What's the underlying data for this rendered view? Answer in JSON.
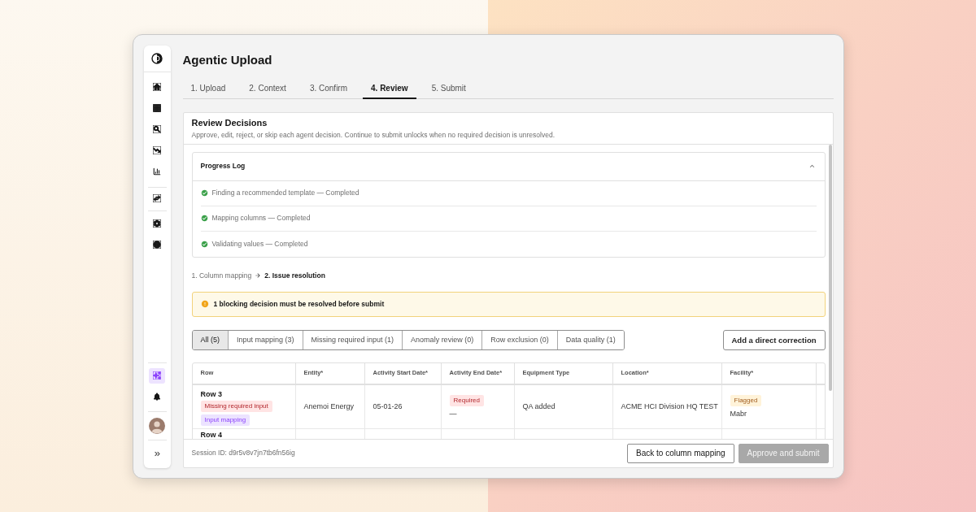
{
  "sidebar": {
    "groups": [
      {
        "items": [
          {
            "selected": false
          },
          {
            "selected": false
          },
          {
            "selected": false
          },
          {
            "selected": false
          },
          {
            "selected": false
          }
        ]
      },
      {
        "items": [
          {
            "selected": false
          }
        ]
      },
      {
        "items": [
          {
            "selected": false
          },
          {
            "selected": false
          }
        ]
      }
    ],
    "bottom_items": [
      {
        "selected": true
      },
      {
        "selected": false
      }
    ]
  },
  "page": {
    "title": "Agentic Upload"
  },
  "steps": [
    {
      "label": "1. Upload",
      "selected": false
    },
    {
      "label": "2. Context",
      "selected": false
    },
    {
      "label": "3. Confirm",
      "selected": false
    },
    {
      "label": "4. Review",
      "selected": true
    },
    {
      "label": "5. Submit",
      "selected": false
    }
  ],
  "review": {
    "title": "Review Decisions",
    "description": "Approve, edit, reject, or skip each agent decision. Continue to submit unlocks when no required decision is unresolved.",
    "progress_log": {
      "title": "Progress Log",
      "expanded": true,
      "items": [
        {
          "text": "Finding a recommended template — Completed",
          "done": true
        },
        {
          "text": "Mapping columns — Completed",
          "done": true
        },
        {
          "text": "Validating values — Completed",
          "done": true
        }
      ]
    },
    "stages": [
      {
        "label": "1. Column mapping",
        "selected": false
      },
      {
        "label": "2. Issue resolution",
        "selected": true
      }
    ],
    "alert": {
      "kind": "warning",
      "text": "1 blocking decision must be resolved before submit"
    },
    "filters": [
      {
        "label": "All (5)",
        "selected": true
      },
      {
        "label": "Input mapping (3)",
        "selected": false
      },
      {
        "label": "Missing required input (1)",
        "selected": false
      },
      {
        "label": "Anomaly review (0)",
        "selected": false
      },
      {
        "label": "Row exclusion (0)",
        "selected": false
      },
      {
        "label": "Data quality (1)",
        "selected": false
      }
    ],
    "add_correction_button": "Add a direct correction",
    "table": {
      "columns": [
        "Row",
        "Entity*",
        "Activity Start Date*",
        "Activity End Date*",
        "Equipment Type",
        "Location*",
        "Facility*"
      ],
      "rows": [
        {
          "row": "Row 3",
          "tags": [
            {
              "label": "Missing required input",
              "kind": "error"
            },
            {
              "label": "Input mapping",
              "kind": "mapping"
            }
          ],
          "cells": [
            {
              "value": "Anemoi Energy"
            },
            {
              "value": "05-01-26"
            },
            {
              "tag": {
                "label": "Required",
                "kind": "error"
              },
              "value": "—"
            },
            {
              "value": "QA added"
            },
            {
              "value": "ACME HCI Division HQ TEST"
            },
            {
              "tag": {
                "label": "Flagged",
                "kind": "warning"
              },
              "value": "Mabr"
            }
          ]
        },
        {
          "row": "Row 4"
        }
      ]
    },
    "footer": {
      "session": "Session ID: d9r5v8v7jn7tb6fn56ig",
      "buttons": [
        {
          "label": "Back to column mapping",
          "kind": "secondary",
          "disabled": false
        },
        {
          "label": "Approve and submit",
          "kind": "primary",
          "disabled": true
        }
      ]
    }
  }
}
